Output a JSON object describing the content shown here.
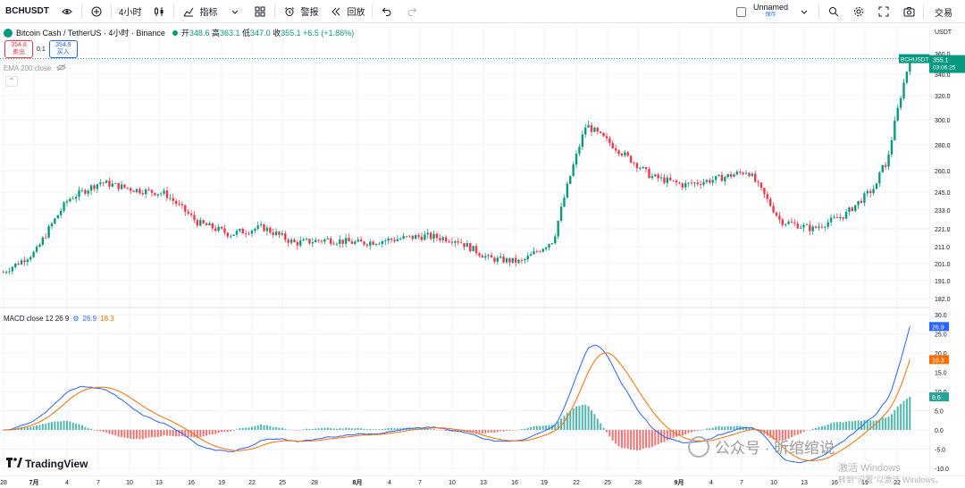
{
  "toolbar": {
    "symbol": "BCHUSDT",
    "interval": "4小时",
    "indicators": "指标",
    "alert": "警报",
    "replay": "回放",
    "layout_name": "Unnamed",
    "layout_sub": "保存",
    "trade": "交易",
    "icons": [
      "plus-circle-icon",
      "candles-icon",
      "indicators-icon",
      "layout-icon",
      "alarm-icon",
      "replay-icon",
      "undo-icon",
      "redo-icon",
      "search-icon",
      "settings-icon",
      "fullscreen-icon",
      "camera-icon"
    ]
  },
  "legend": {
    "title": "Bitcoin Cash / TetherUS · 4小时 · Binance",
    "open_label": "开",
    "open": "348.6",
    "high_label": "高",
    "high": "363.1",
    "low_label": "低",
    "low": "347.0",
    "close_label": "收",
    "close": "355.1",
    "change": "+6.5 (+1.86%)",
    "sell_price": "354.8",
    "sell_label": "卖出",
    "spread": "0.1",
    "buy_price": "354.9",
    "buy_label": "买入",
    "ema": "EMA 200 close"
  },
  "macd_legend": {
    "name": "MACD close 12 26 9",
    "macd": "26.9",
    "signal": "18.3"
  },
  "price_axis": {
    "currency": "USDT",
    "ticks": [
      "360.0",
      "340.0",
      "320.0",
      "300.0",
      "280.0",
      "260.0",
      "245.0",
      "233.0",
      "221.0",
      "211.0",
      "201.0",
      "191.0",
      "182.0"
    ],
    "last_label": "BCHUSDT",
    "last_value": "355.1",
    "countdown": "03:06:25"
  },
  "macd_axis": {
    "ticks": [
      "30.0",
      "25.0",
      "20.0",
      "15.0",
      "10.0",
      "5.0",
      "0.0",
      "-5.0",
      "-10.0"
    ],
    "macd_badge": "26.9",
    "signal_badge": "18.3",
    "hist_badge": "8.6"
  },
  "time_axis": [
    "28",
    "7月",
    "4",
    "7",
    "10",
    "13",
    "16",
    "19",
    "22",
    "25",
    "28",
    "8月",
    "4",
    "7",
    "10",
    "13",
    "16",
    "19",
    "22",
    "25",
    "28",
    "9月",
    "4",
    "7",
    "10",
    "13",
    "16",
    "19",
    "22"
  ],
  "colors": {
    "up": "#089981",
    "down": "#f23645",
    "macd": "#2962ff",
    "signal": "#ff6d00",
    "accent": "#2962ff"
  },
  "branding": "TradingView",
  "watermark": "公众号 · 昕绾绾说",
  "activate_line1": "激活 Windows",
  "activate_line2": "转到\"设置\"以激活 Windows。",
  "chart_data": {
    "type": "candlestick",
    "main": {
      "series": "BCHUSDT",
      "y_ticks": [
        360,
        340,
        320,
        300,
        280,
        260,
        245,
        233,
        221,
        211,
        201,
        191,
        182
      ],
      "last": 355.1,
      "approx_path": [
        {
          "x": "28",
          "y": 196
        },
        {
          "x": "7月",
          "y": 208
        },
        {
          "x": "4",
          "y": 240
        },
        {
          "x": "7",
          "y": 252
        },
        {
          "x": "10",
          "y": 247
        },
        {
          "x": "13",
          "y": 244
        },
        {
          "x": "16",
          "y": 225
        },
        {
          "x": "19",
          "y": 218
        },
        {
          "x": "22",
          "y": 222
        },
        {
          "x": "25",
          "y": 213
        },
        {
          "x": "28",
          "y": 215
        },
        {
          "x": "8月",
          "y": 213
        },
        {
          "x": "4",
          "y": 215
        },
        {
          "x": "7",
          "y": 217
        },
        {
          "x": "10",
          "y": 215
        },
        {
          "x": "13",
          "y": 204
        },
        {
          "x": "16",
          "y": 202
        },
        {
          "x": "19",
          "y": 215
        },
        {
          "x": "22",
          "y": 296
        },
        {
          "x": "25",
          "y": 276
        },
        {
          "x": "28",
          "y": 256
        },
        {
          "x": "9月",
          "y": 250
        },
        {
          "x": "4",
          "y": 254
        },
        {
          "x": "7",
          "y": 260
        },
        {
          "x": "10",
          "y": 226
        },
        {
          "x": "13",
          "y": 221
        },
        {
          "x": "16",
          "y": 230
        },
        {
          "x": "19",
          "y": 250
        },
        {
          "x": "22",
          "y": 355
        }
      ]
    },
    "macd": {
      "y_ticks": [
        30,
        25,
        20,
        15,
        10,
        5,
        0,
        -5,
        -10
      ],
      "macd": 26.9,
      "signal": 18.3,
      "histogram": 8.6
    }
  }
}
